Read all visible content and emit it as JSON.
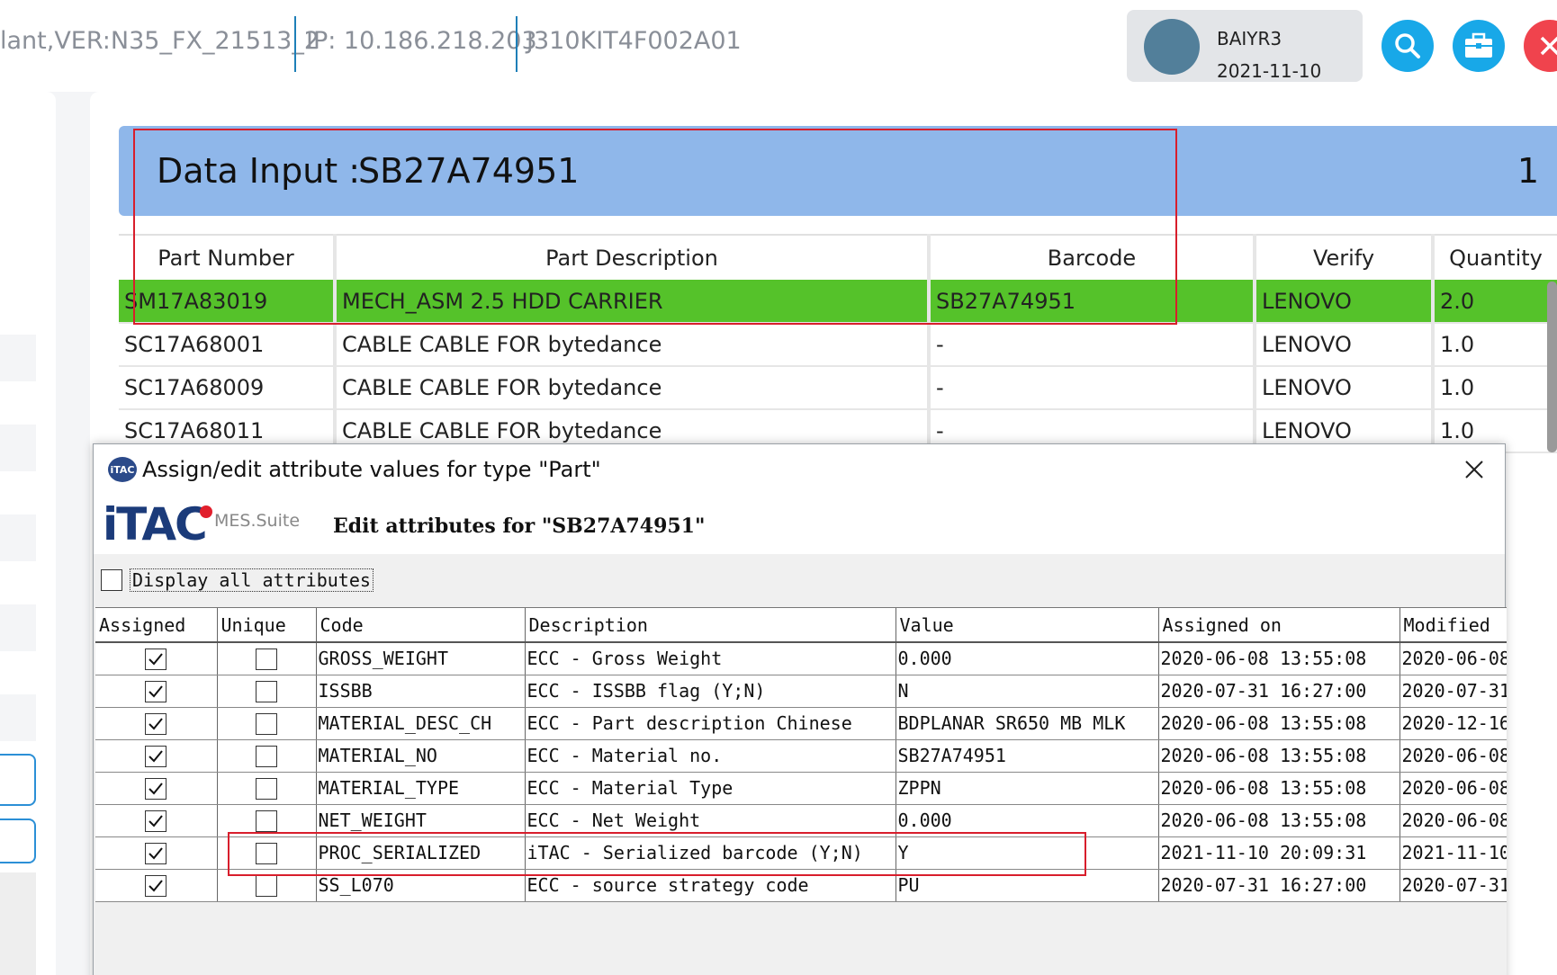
{
  "header": {
    "segments": [
      "lant,VER:N35_FX_21513_2",
      "IP: 10.186.218.203",
      "J310KIT4F002A01"
    ],
    "user": {
      "name": "BAIYR3",
      "date": "2021-11-10"
    },
    "buttons": {
      "search": "search-icon",
      "case": "briefcase-icon",
      "close": "close-icon"
    }
  },
  "data_input": {
    "label": "Data Input :",
    "value": "SB27A74951",
    "count": "1"
  },
  "parts_table": {
    "columns": [
      "Part Number",
      "Part Description",
      "Barcode",
      "Verify",
      "Quantity"
    ],
    "rows": [
      [
        "SM17A83019",
        "MECH_ASM 2.5 HDD CARRIER",
        "SB27A74951",
        "LENOVO",
        "2.0"
      ],
      [
        "SC17A68001",
        "CABLE CABLE FOR bytedance",
        "-",
        "LENOVO",
        "1.0"
      ],
      [
        "SC17A68009",
        "CABLE CABLE FOR bytedance",
        "-",
        "LENOVO",
        "1.0"
      ],
      [
        "SC17A68011",
        "CABLE CABLE FOR bytedance",
        "-",
        "LENOVO",
        "1.0"
      ]
    ],
    "highlight_color": "#55c22a"
  },
  "dialog": {
    "title": "Assign/edit attribute values for type \"Part\"",
    "app_icon_text": "iTAC",
    "logo": {
      "word": "iTAC",
      "suite": "MES.Suite"
    },
    "heading": "Edit attributes for \"SB27A74951\"",
    "display_all_label": "Display all attributes",
    "display_all_checked": false,
    "columns": [
      "Assigned",
      "Unique",
      "Code",
      "Description",
      "Value",
      "Assigned on",
      "Modified"
    ],
    "rows": [
      {
        "assigned": true,
        "unique": false,
        "code": "GROSS_WEIGHT",
        "description": "ECC - Gross Weight",
        "value": "0.000",
        "assigned_on": "2020-06-08 13:55:08",
        "modified": "2020-06-08"
      },
      {
        "assigned": true,
        "unique": false,
        "code": "ISSBB",
        "description": "ECC - ISSBB flag (Y;N)",
        "value": "N",
        "assigned_on": "2020-07-31 16:27:00",
        "modified": "2020-07-31"
      },
      {
        "assigned": true,
        "unique": false,
        "code": "MATERIAL_DESC_CH",
        "description": "ECC - Part description Chinese",
        "value": "BDPLANAR SR650 MB MLK",
        "assigned_on": "2020-06-08 13:55:08",
        "modified": "2020-12-16"
      },
      {
        "assigned": true,
        "unique": false,
        "code": "MATERIAL_NO",
        "description": "ECC - Material no.",
        "value": "SB27A74951",
        "assigned_on": "2020-06-08 13:55:08",
        "modified": "2020-06-08"
      },
      {
        "assigned": true,
        "unique": false,
        "code": "MATERIAL_TYPE",
        "description": "ECC - Material Type",
        "value": "ZPPN",
        "assigned_on": "2020-06-08 13:55:08",
        "modified": "2020-06-08"
      },
      {
        "assigned": true,
        "unique": false,
        "code": "NET_WEIGHT",
        "description": "ECC - Net Weight",
        "value": "0.000",
        "assigned_on": "2020-06-08 13:55:08",
        "modified": "2020-06-08"
      },
      {
        "assigned": true,
        "unique": false,
        "code": "PROC_SERIALIZED",
        "description": "iTAC - Serialized barcode (Y;N)",
        "value": "Y",
        "assigned_on": "2021-11-10 20:09:31",
        "modified": "2021-11-10"
      },
      {
        "assigned": true,
        "unique": false,
        "code": "SS_L070",
        "description": "ECC -  source strategy code",
        "value": "PU",
        "assigned_on": "2020-07-31 16:27:00",
        "modified": "2020-07-31"
      }
    ]
  },
  "colors": {
    "accent": "#18a8e8",
    "danger": "#f0434d",
    "data_input_bg": "#8fb7ea",
    "annotation_red": "#d81e2c"
  }
}
